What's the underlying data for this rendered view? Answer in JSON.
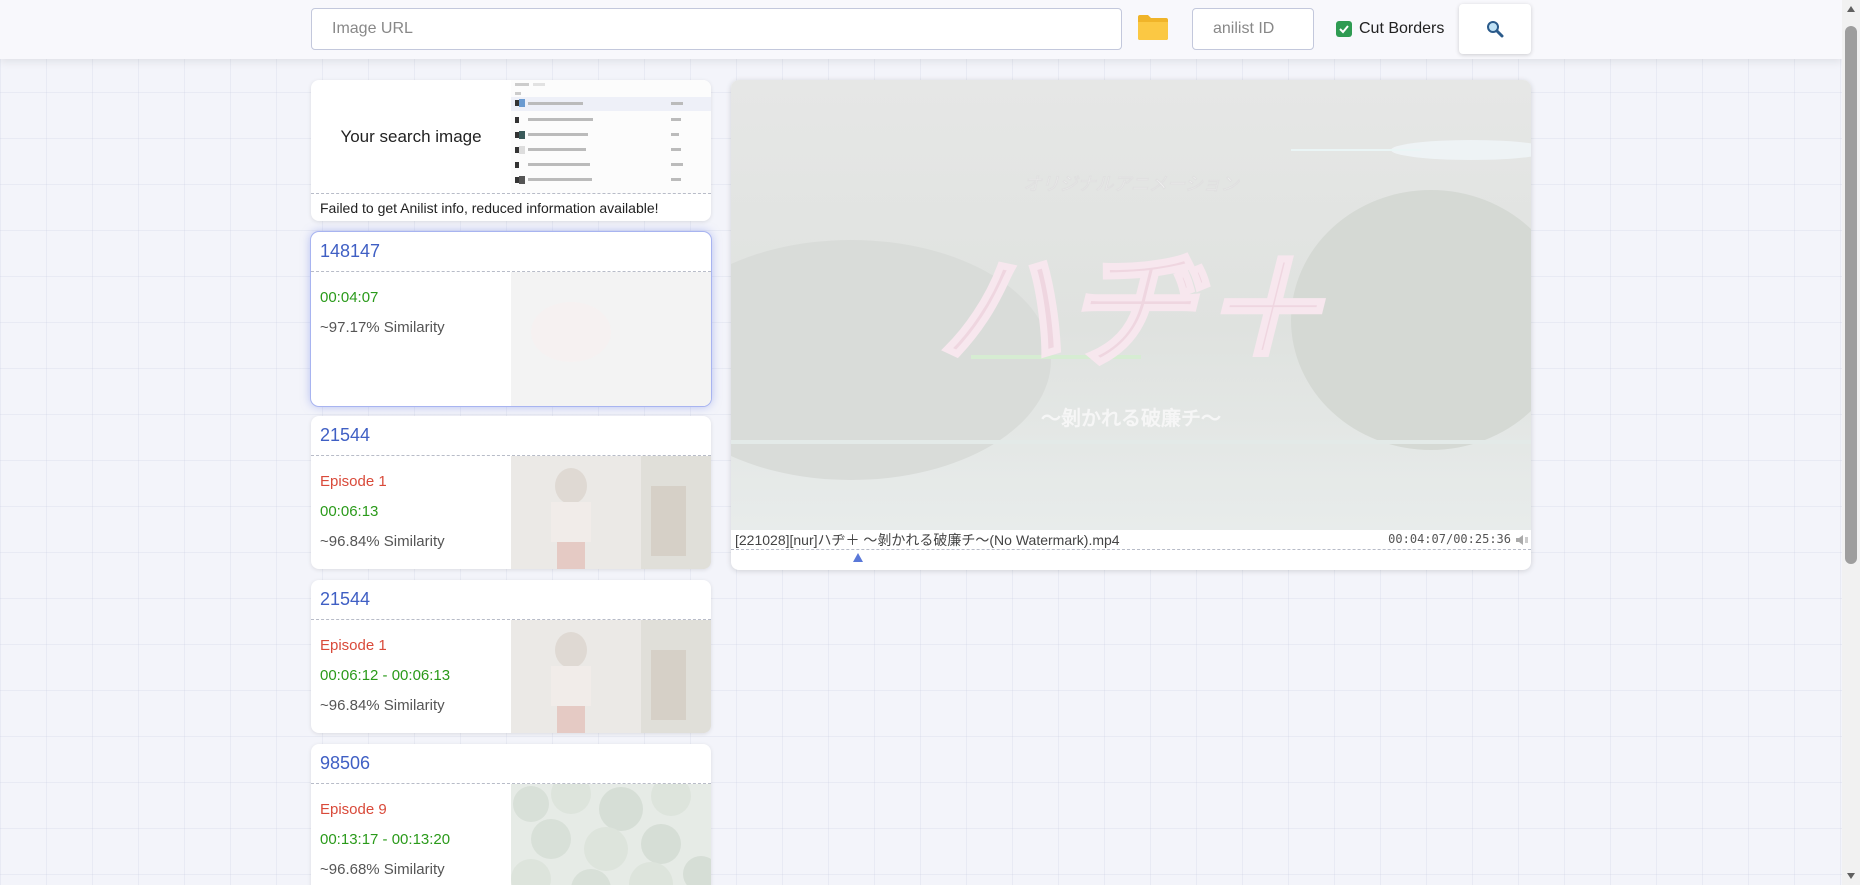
{
  "toolbar": {
    "url_placeholder": "Image URL",
    "url_value": "",
    "folder_icon": "folder-icon",
    "anilist_placeholder": "anilist ID",
    "anilist_value": "",
    "cut_borders_label": "Cut Borders",
    "cut_borders_checked": true,
    "search_icon": "magnifier-icon"
  },
  "search_image": {
    "label": "Your search image",
    "info": "Failed to get Anilist info, reduced information available!"
  },
  "results": [
    {
      "title": "148147",
      "episode": "",
      "time": "00:04:07",
      "similarity": "~97.17% Similarity",
      "selected": true
    },
    {
      "title": "21544",
      "episode": "Episode 1",
      "time": "00:06:13",
      "similarity": "~96.84% Similarity",
      "selected": false
    },
    {
      "title": "21544",
      "episode": "Episode 1",
      "time": "00:06:12 - 00:06:13",
      "similarity": "~96.84% Similarity",
      "selected": false
    },
    {
      "title": "98506",
      "episode": "Episode 9",
      "time": "00:13:17 - 00:13:20",
      "similarity": "~96.68% Similarity",
      "selected": false
    }
  ],
  "player": {
    "filename": "[221028][nur]ハヂ＋ ～剝かれる破廉チ～(No Watermark).mp4",
    "timecode": "00:04:07/00:25:36",
    "volume_icon": "speaker-icon",
    "progress_fraction": 0.161
  },
  "colors": {
    "accent": "#3f5fc4",
    "episode": "#d94a3a",
    "time": "#2a9a1a",
    "checkbox": "#2e9b52"
  }
}
